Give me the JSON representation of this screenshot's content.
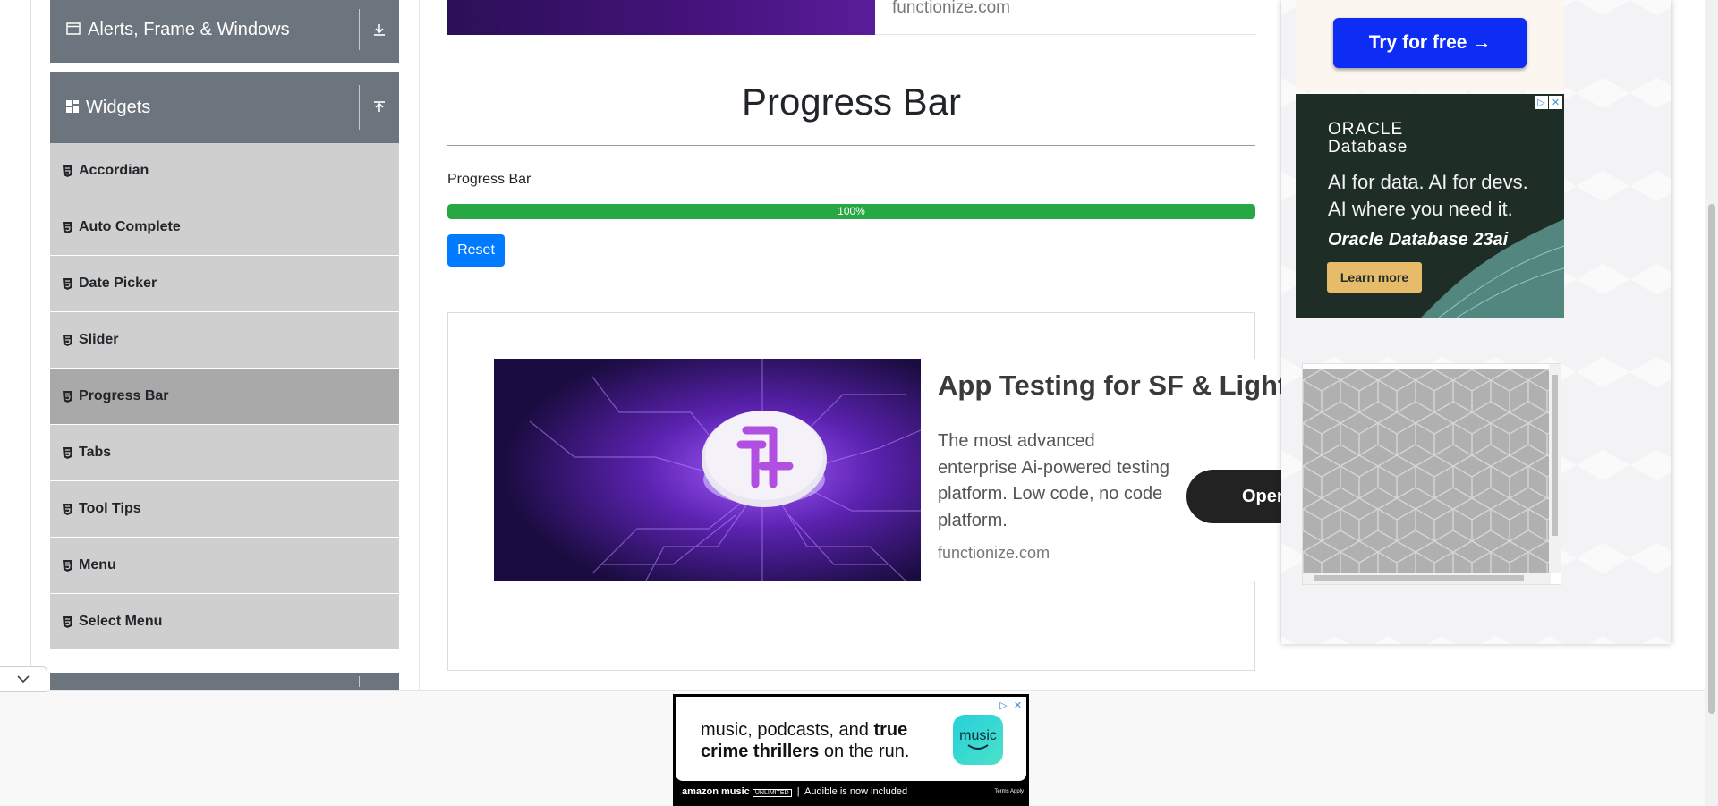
{
  "sidebar": {
    "groups": {
      "alerts": {
        "label": "Alerts, Frame & Windows",
        "icon": "window-icon",
        "arrow": "download-arrow-icon"
      },
      "widgets": {
        "label": "Widgets",
        "icon": "widgets-grid-icon",
        "arrow": "upload-arrow-icon"
      }
    },
    "items": [
      {
        "label": "Accordian",
        "active": false
      },
      {
        "label": "Auto Complete",
        "active": false
      },
      {
        "label": "Date Picker",
        "active": false
      },
      {
        "label": "Slider",
        "active": false
      },
      {
        "label": "Progress Bar",
        "active": true
      },
      {
        "label": "Tabs",
        "active": false
      },
      {
        "label": "Tool Tips",
        "active": false
      },
      {
        "label": "Menu",
        "active": false
      },
      {
        "label": "Select Menu",
        "active": false
      }
    ]
  },
  "top_ad": {
    "domain": "functionize.com"
  },
  "main": {
    "title": "Progress Bar",
    "progress": {
      "label": "Progress Bar",
      "value_percent": 100,
      "text": "100%",
      "fill_color": "#28a745"
    },
    "reset_label": "Reset"
  },
  "ad_functionize": {
    "heading": "App Testing for SF & Lightn",
    "body": "The most advanced enterprise Ai-powered testing platform. Low code, no code platform.",
    "domain": "functionize.com",
    "cta": "Open"
  },
  "right_ads": {
    "try_button": "Try for free →",
    "oracle": {
      "brand": "ORACLE",
      "product_line": "Database",
      "line1": "AI for data. AI for devs.",
      "line2": "AI where you need it.",
      "product": "Oracle Database 23ai",
      "cta": "Learn more"
    }
  },
  "amazon_ad": {
    "text_plain": "music, podcasts, and ",
    "text_bold": "true crime thrillers",
    "text_end": " on the run.",
    "logo_label": "music",
    "footer_brand": "amazon music",
    "footer_tag": "UNLIMITED",
    "footer_text": "Audible is now included",
    "terms": "Terms Apply"
  },
  "colors": {
    "sidebar_header": "#6c757d",
    "sidebar_item": "#cfcfcf",
    "sidebar_item_active": "#a9a9a9",
    "primary_button": "#007bff",
    "try_button": "#0d2df5",
    "oracle_bg": "#1e2e26",
    "oracle_button": "#e6bb69"
  }
}
